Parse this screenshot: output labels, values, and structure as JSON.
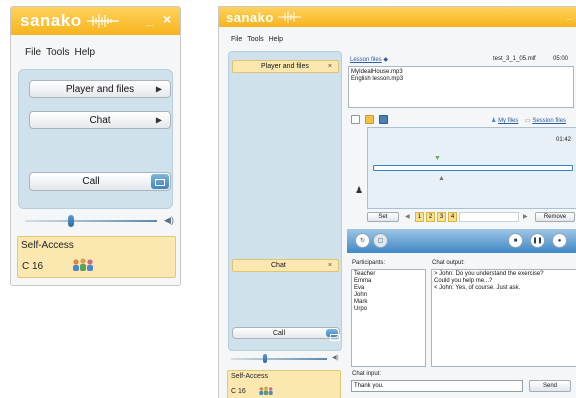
{
  "app": {
    "logo": "sanako",
    "minimize": "_",
    "close": "×"
  },
  "menu": {
    "file": "File",
    "tools": "Tools",
    "help": "Help"
  },
  "compact": {
    "player_files_button": "Player and files",
    "chat_button": "Chat",
    "call_button": "Call",
    "self_access": "Self-Access",
    "class_code": "C 16"
  },
  "expanded": {
    "player_files_tab": "Player and files",
    "chat_tab": "Chat",
    "call_button": "Call",
    "self_access": "Self-Access",
    "class_code": "C 16",
    "close_symbol": "×",
    "lesson_files_link": "Lesson files",
    "lesson_info": "test_3_1_05.mlf",
    "lesson_time": "05:00",
    "files": [
      "MyIdealHouse.mp3",
      "English lesson.mp3"
    ],
    "my_files_link": "My files",
    "session_files_link": "Session files",
    "current_time": "01:42",
    "set_button": "Set",
    "segments": [
      "1",
      "2",
      "3",
      "4"
    ],
    "remove_button": "Remove",
    "participants_label": "Participants:",
    "participants": [
      "Teacher",
      "Emma",
      "Eva",
      "John",
      "Mark",
      "Urpo"
    ],
    "chat_output_label": "Chat output:",
    "chat_lines": [
      "> John: Do you understand the exercise?",
      "Could you help me...?",
      "< John: Yes, of course. Just ask."
    ],
    "chat_input_label": "Chat input:",
    "chat_input_value": "Thank you.",
    "send_button": "Send"
  },
  "colors": {
    "titlebar": "#f6b41d",
    "panel": "#cfe2ec",
    "tab_highlight": "#fbe7b0",
    "player_bar": "#3f87c4"
  },
  "volume_level": 0.35
}
